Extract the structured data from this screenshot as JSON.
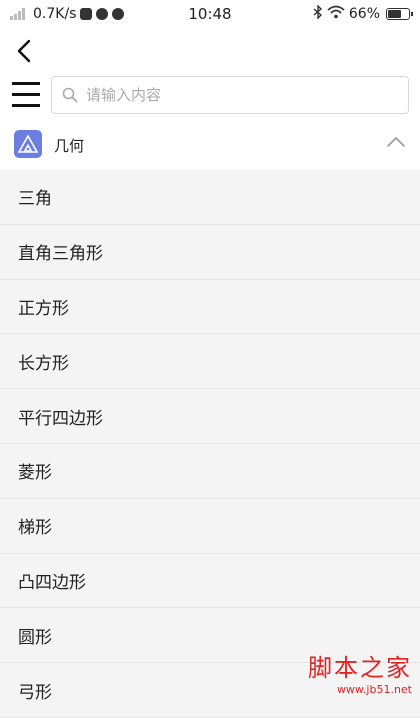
{
  "status_bar": {
    "network_speed": "0.7K/s",
    "time": "10:48",
    "battery": "66%",
    "battery_level": 0.66
  },
  "search": {
    "placeholder": "请输入内容",
    "value": ""
  },
  "category": {
    "label": "几何",
    "icon": "triangle-geometry-icon",
    "expanded": true,
    "accent_color": "#6b7fe3"
  },
  "items": [
    {
      "label": "三角"
    },
    {
      "label": "直角三角形"
    },
    {
      "label": "正方形"
    },
    {
      "label": "长方形"
    },
    {
      "label": "平行四边形"
    },
    {
      "label": "菱形"
    },
    {
      "label": "梯形"
    },
    {
      "label": "凸四边形"
    },
    {
      "label": "圆形"
    },
    {
      "label": "弓形"
    }
  ],
  "watermark": {
    "main": "脚本之家",
    "url": "www.jb51.net",
    "color": "#e02424"
  }
}
